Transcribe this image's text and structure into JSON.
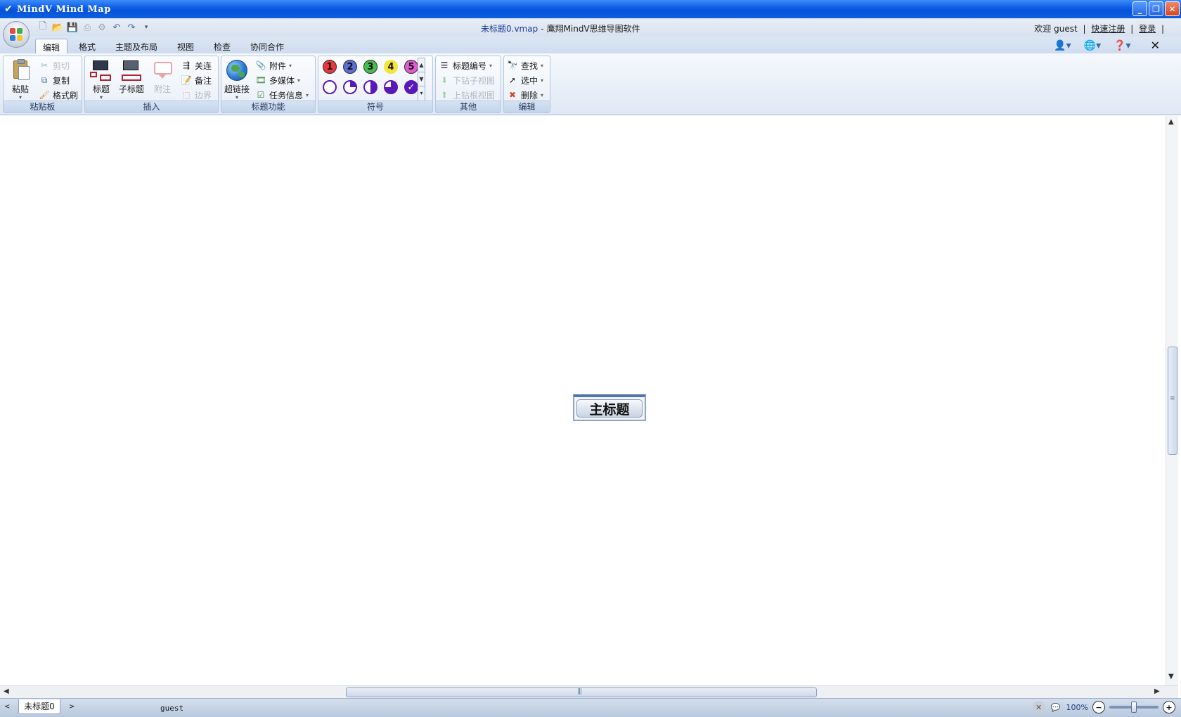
{
  "window": {
    "title": "MindV Mind Map",
    "buttons": {
      "minimize": "_",
      "restore": "❐",
      "close": "✕"
    }
  },
  "header": {
    "file_name": "未标题0.vmap",
    "separator": "-",
    "app_name": "鹰翔MindV思维导图软件",
    "welcome": "欢迎 guest",
    "divider": "|",
    "register": "快速注册",
    "login": "登录"
  },
  "tabs": [
    {
      "label": "编辑",
      "active": true
    },
    {
      "label": "格式"
    },
    {
      "label": "主题及布局"
    },
    {
      "label": "视图"
    },
    {
      "label": "检查"
    },
    {
      "label": "协同合作"
    }
  ],
  "ribbon": {
    "clipboard": {
      "label": "粘贴板",
      "paste": "粘贴",
      "cut": "剪切",
      "copy": "复制",
      "format_painter": "格式刷"
    },
    "insert": {
      "label": "插入",
      "topic": "标题",
      "subtopic": "子标题",
      "callout": "附注",
      "relation": "关连",
      "note": "备注",
      "boundary": "边界"
    },
    "topic_functions": {
      "label": "标题功能",
      "hyperlink": "超链接",
      "attachment": "附件",
      "multimedia": "多媒体",
      "task_info": "任务信息"
    },
    "symbols": {
      "label": "符号",
      "numbers": [
        "1",
        "2",
        "3",
        "4",
        "5"
      ],
      "check": "✓"
    },
    "other": {
      "label": "其他",
      "numbering": "标题编号",
      "sub_map_down": "下钻子视图",
      "sub_map_up": "上钻根视图"
    },
    "edit": {
      "label": "编辑",
      "find": "查找",
      "select": "选中",
      "delete": "删除"
    }
  },
  "canvas": {
    "main_topic": "主标题"
  },
  "statusbar": {
    "sheet": "未标题0",
    "user": "guest",
    "zoom": "100%"
  },
  "colors": {
    "titlebar": "#0b5ae6",
    "topic_border": "#4f74b0",
    "sym1": "#e8383d",
    "sym2": "#5b6fd6",
    "sym3": "#46c04a",
    "sym4": "#f5e43a",
    "sym5": "#e35ad3",
    "progress": "#5a18b8"
  }
}
